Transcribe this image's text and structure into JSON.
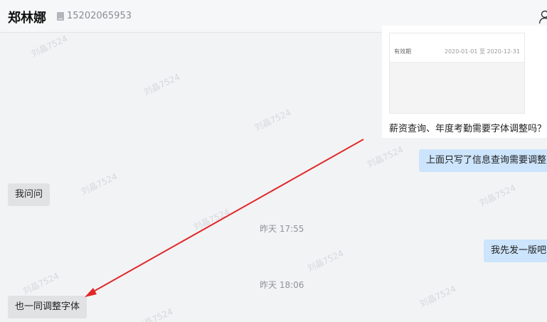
{
  "header": {
    "contact_name": "郑林娜",
    "phone": "15202065953"
  },
  "watermark_text": "刘晶7524",
  "card": {
    "validity_label": "有效期",
    "validity_range": "2020-01-01 至 2020-12-31",
    "text": "薪资查询、年度考勤需要字体调整吗？"
  },
  "messages": {
    "right_1": "上面只写了信息查询需要调整",
    "left_1": "我问问",
    "right_2": "我先发一版吧",
    "left_2": "也一同调整字体"
  },
  "timestamps": {
    "t1": "昨天 17:55",
    "t2": "昨天 18:06"
  },
  "annotation": {
    "arrow_color": "#e02828"
  },
  "colors": {
    "background": "#f2f3f5",
    "bubble_left": "#e1e2e4",
    "bubble_right": "#cce4fc"
  }
}
